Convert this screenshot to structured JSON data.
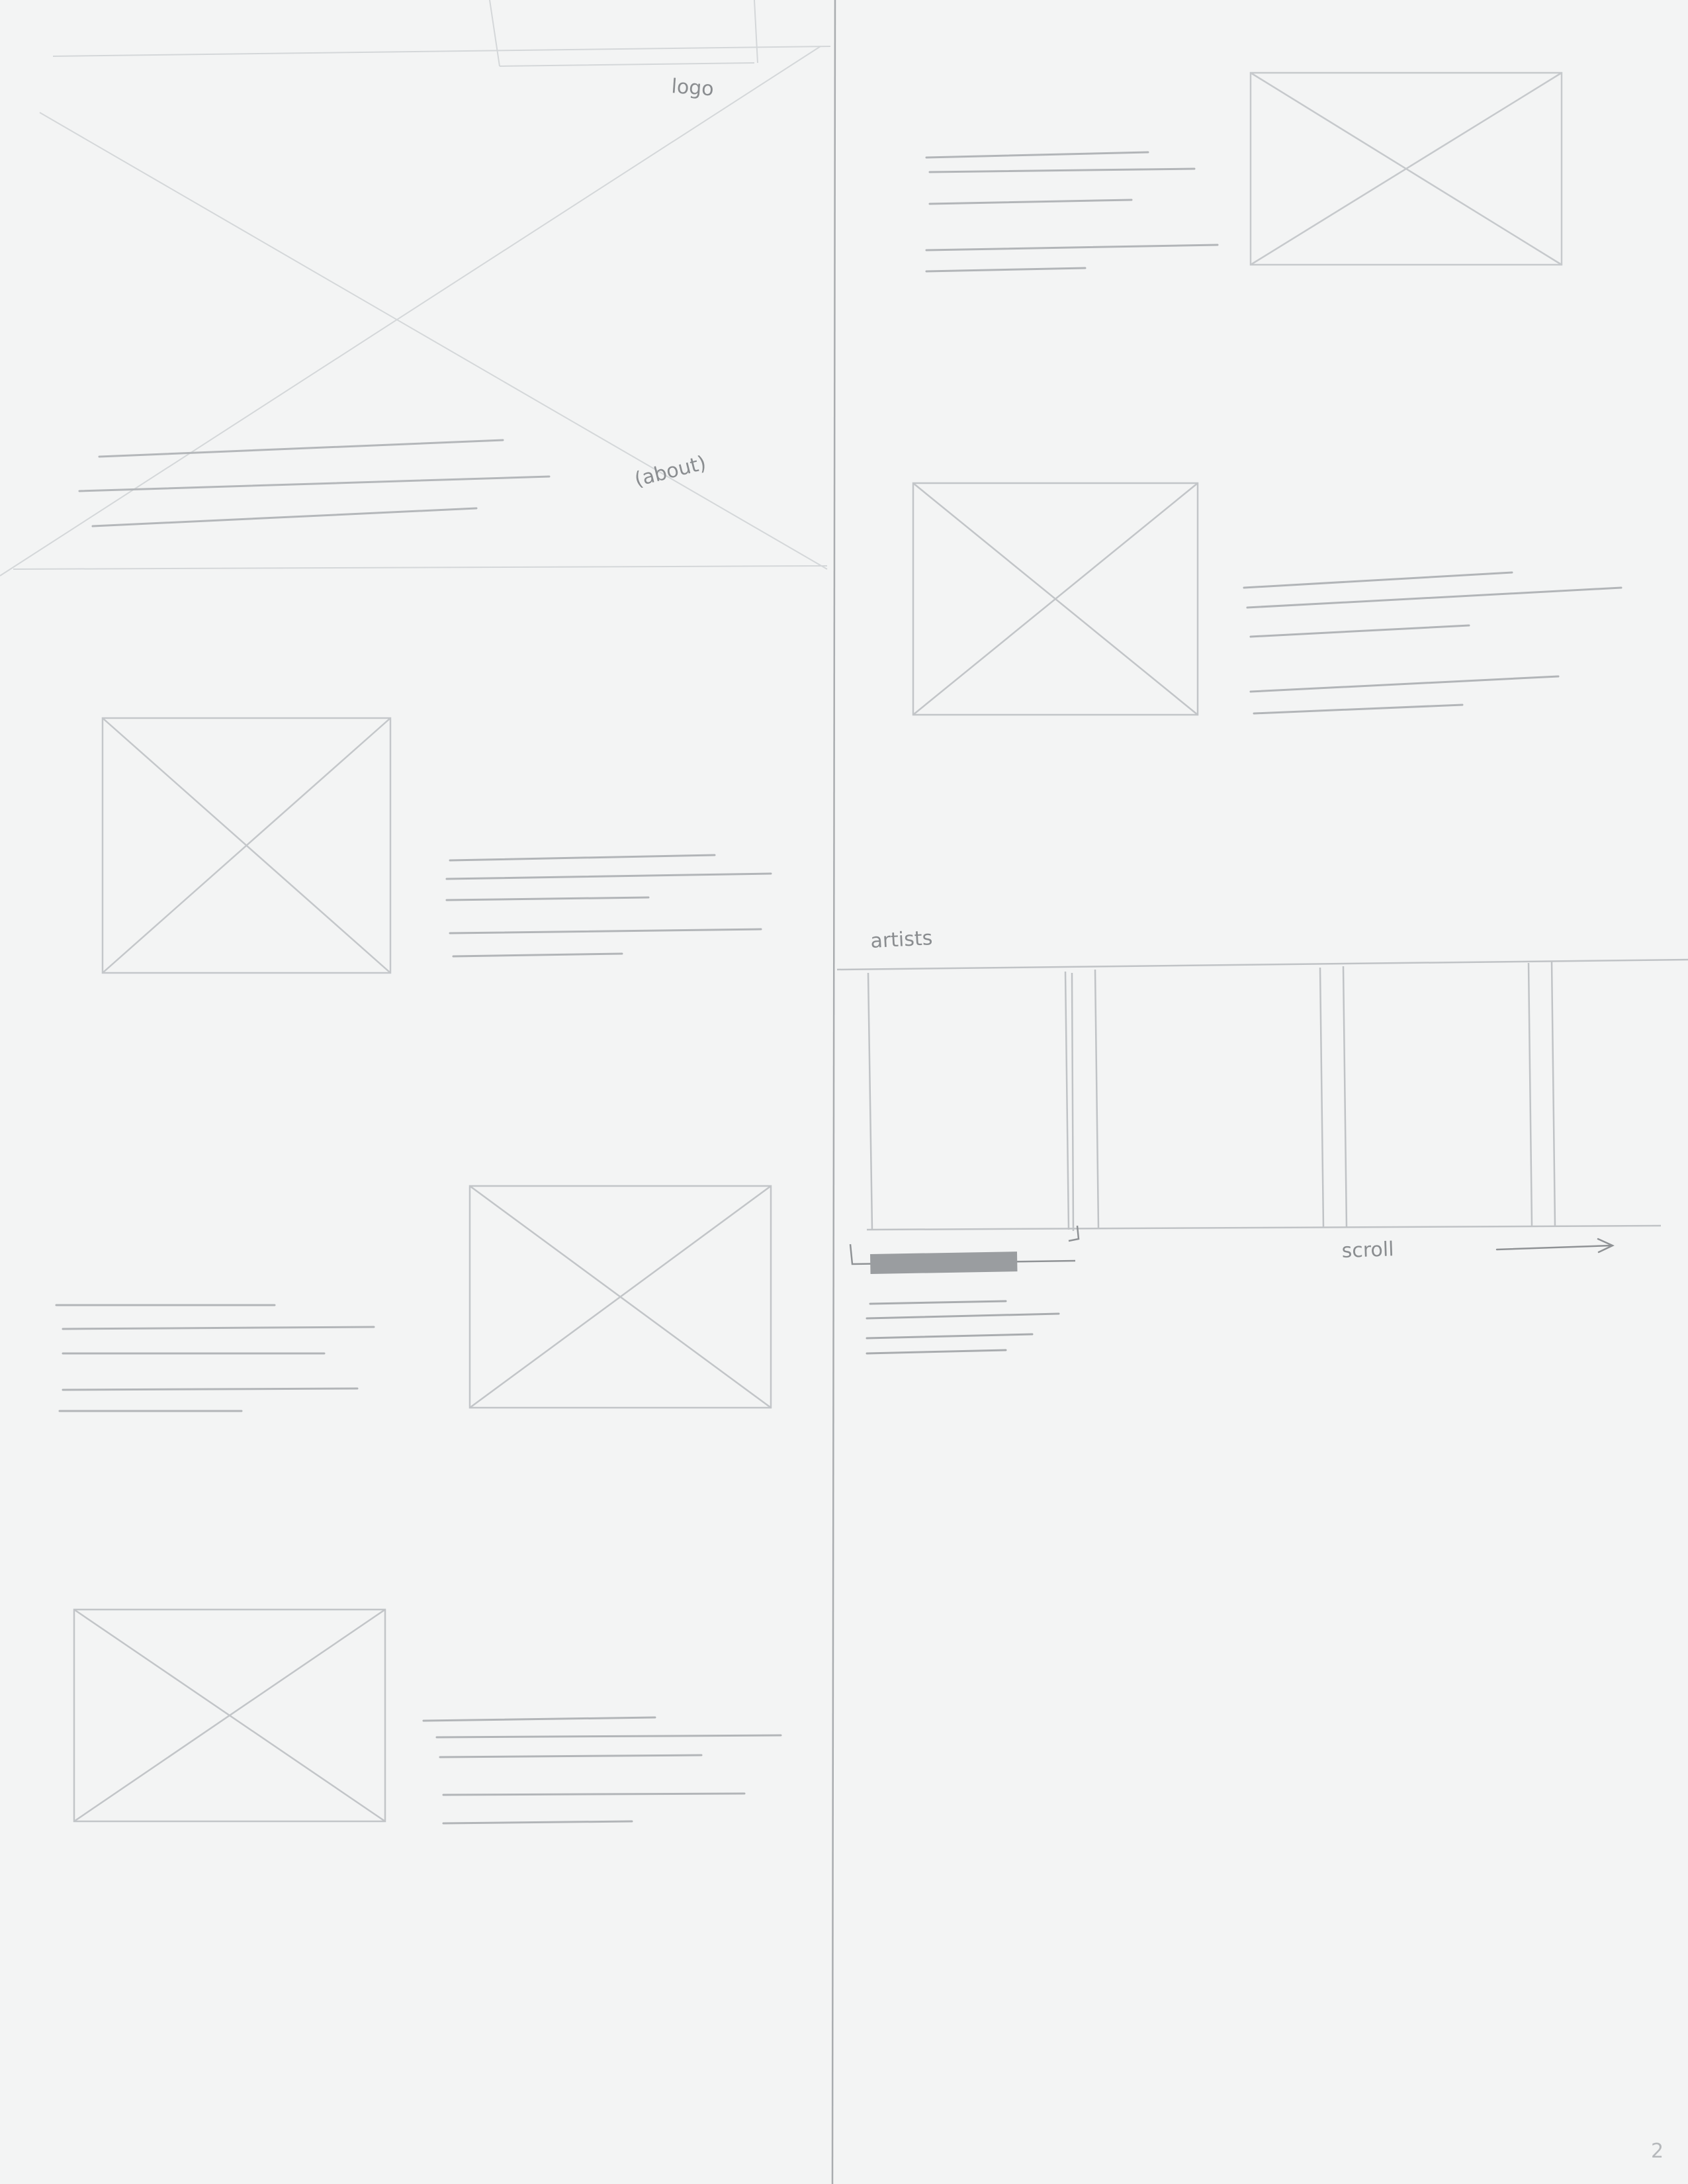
{
  "annotations": {
    "logo": "logo",
    "about": "(about)",
    "artists": "artists",
    "scroll": "scroll",
    "page_number": "2"
  },
  "colors": {
    "paper": "#f3f4f4",
    "pencil_light": "#cfd2d4",
    "pencil_mid": "#b9bcbf",
    "pencil_dark": "#8f9295",
    "fill_bar": "#9a9da0"
  }
}
